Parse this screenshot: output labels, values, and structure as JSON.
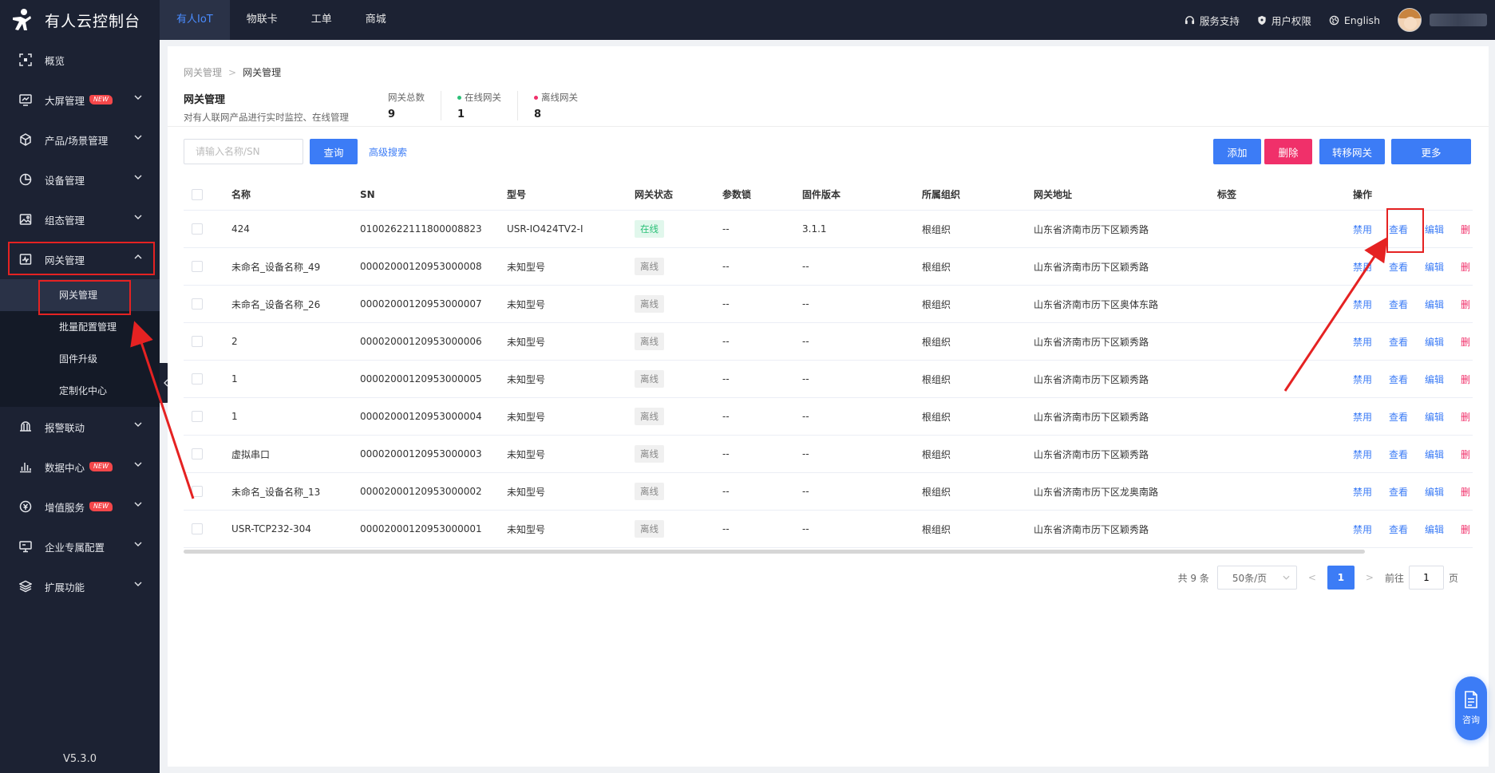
{
  "app": {
    "title": "有人云控制台",
    "version": "V5.3.0"
  },
  "topnav": [
    {
      "label": "有人IoT",
      "active": true
    },
    {
      "label": "物联卡",
      "active": false
    },
    {
      "label": "工单",
      "active": false
    },
    {
      "label": "商城",
      "active": false
    }
  ],
  "topright": {
    "support": "服务支持",
    "permission": "用户权限",
    "language": "English"
  },
  "sidebar": {
    "items": [
      {
        "label": "概览",
        "icon": "scan-icon",
        "new": false,
        "chevron": false
      },
      {
        "label": "大屏管理",
        "icon": "monitor-icon",
        "new": true,
        "chevron": true
      },
      {
        "label": "产品/场景管理",
        "icon": "cube-icon",
        "new": false,
        "chevron": true
      },
      {
        "label": "设备管理",
        "icon": "pie-icon",
        "new": false,
        "chevron": true
      },
      {
        "label": "组态管理",
        "icon": "image-icon",
        "new": false,
        "chevron": true
      },
      {
        "label": "网关管理",
        "icon": "gateway-icon",
        "new": false,
        "chevron": true,
        "expanded": true
      },
      {
        "label": "报警联动",
        "icon": "bell-icon",
        "new": false,
        "chevron": true
      },
      {
        "label": "数据中心",
        "icon": "bar-chart-icon",
        "new": true,
        "chevron": true
      },
      {
        "label": "增值服务",
        "icon": "coin-icon",
        "new": true,
        "chevron": true
      },
      {
        "label": "企业专属配置",
        "icon": "desktop-icon",
        "new": false,
        "chevron": true
      },
      {
        "label": "扩展功能",
        "icon": "layers-icon",
        "new": false,
        "chevron": true
      }
    ],
    "new_badge": "NEW",
    "sub_items": [
      {
        "label": "网关管理",
        "active": true
      },
      {
        "label": "批量配置管理",
        "active": false
      },
      {
        "label": "固件升级",
        "active": false
      },
      {
        "label": "定制化中心",
        "active": false
      }
    ]
  },
  "breadcrumb": {
    "parent": "网关管理",
    "current": "网关管理"
  },
  "header": {
    "title": "网关管理",
    "desc": "对有人联网产品进行实时监控、在线管理"
  },
  "stats": [
    {
      "label": "网关总数",
      "value": "9",
      "dot": ""
    },
    {
      "label": "在线网关",
      "value": "1",
      "dot": "#2cc078"
    },
    {
      "label": "离线网关",
      "value": "8",
      "dot": "#f0306a"
    }
  ],
  "search": {
    "placeholder": "请输入名称/SN",
    "query_label": "查询",
    "advanced_label": "高级搜索"
  },
  "actions": {
    "add": "添加",
    "delete": "删除",
    "transfer": "转移网关",
    "more": "更多"
  },
  "table": {
    "columns": [
      "名称",
      "SN",
      "型号",
      "网关状态",
      "参数锁",
      "固件版本",
      "所属组织",
      "网关地址",
      "标签",
      "操作"
    ],
    "ops": {
      "disable": "禁用",
      "view": "查看",
      "edit": "编辑",
      "delete": "删"
    },
    "rows": [
      {
        "name": "424",
        "sn": "01002622111800008823",
        "model": "USR-IO424TV2-I",
        "status": "在线",
        "online": true,
        "lock": "--",
        "fw": "3.1.1",
        "org": "根组织",
        "addr": "山东省济南市历下区颖秀路",
        "tag": ""
      },
      {
        "name": "未命名_设备名称_49",
        "sn": "00002000120953000008",
        "model": "未知型号",
        "status": "离线",
        "online": false,
        "lock": "--",
        "fw": "--",
        "org": "根组织",
        "addr": "山东省济南市历下区颖秀路",
        "tag": ""
      },
      {
        "name": "未命名_设备名称_26",
        "sn": "00002000120953000007",
        "model": "未知型号",
        "status": "离线",
        "online": false,
        "lock": "--",
        "fw": "--",
        "org": "根组织",
        "addr": "山东省济南市历下区奥体东路",
        "tag": ""
      },
      {
        "name": "2",
        "sn": "00002000120953000006",
        "model": "未知型号",
        "status": "离线",
        "online": false,
        "lock": "--",
        "fw": "--",
        "org": "根组织",
        "addr": "山东省济南市历下区颖秀路",
        "tag": ""
      },
      {
        "name": "1",
        "sn": "00002000120953000005",
        "model": "未知型号",
        "status": "离线",
        "online": false,
        "lock": "--",
        "fw": "--",
        "org": "根组织",
        "addr": "山东省济南市历下区颖秀路",
        "tag": ""
      },
      {
        "name": "1",
        "sn": "00002000120953000004",
        "model": "未知型号",
        "status": "离线",
        "online": false,
        "lock": "--",
        "fw": "--",
        "org": "根组织",
        "addr": "山东省济南市历下区颖秀路",
        "tag": ""
      },
      {
        "name": "虚拟串口",
        "sn": "00002000120953000003",
        "model": "未知型号",
        "status": "离线",
        "online": false,
        "lock": "--",
        "fw": "--",
        "org": "根组织",
        "addr": "山东省济南市历下区颖秀路",
        "tag": ""
      },
      {
        "name": "未命名_设备名称_13",
        "sn": "00002000120953000002",
        "model": "未知型号",
        "status": "离线",
        "online": false,
        "lock": "--",
        "fw": "--",
        "org": "根组织",
        "addr": "山东省济南市历下区龙奥南路",
        "tag": ""
      },
      {
        "name": "USR-TCP232-304",
        "sn": "00002000120953000001",
        "model": "未知型号",
        "status": "离线",
        "online": false,
        "lock": "--",
        "fw": "--",
        "org": "根组织",
        "addr": "山东省济南市历下区颖秀路",
        "tag": ""
      }
    ]
  },
  "pagination": {
    "total": "共 9 条",
    "page_size": "50条/页",
    "current": "1",
    "goto_prefix": "前往",
    "goto_value": "1",
    "goto_suffix": "页"
  },
  "consult": {
    "label": "咨询"
  },
  "colors": {
    "accent": "#3c7cf6",
    "danger": "#f0306a",
    "sidebar": "#1c2233",
    "online": "#2cc078",
    "annotation": "#e52222"
  }
}
